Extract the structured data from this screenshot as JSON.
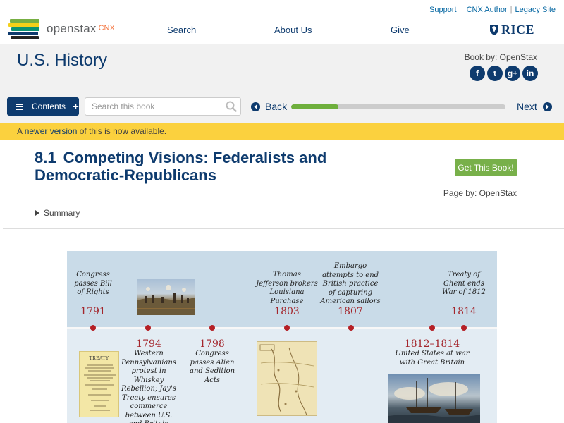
{
  "header": {
    "logo_text": "openstax",
    "logo_suffix": "CNX",
    "util_links": [
      "Support",
      "CNX Author",
      "Legacy Site"
    ],
    "nav": [
      "Search",
      "About Us",
      "Give"
    ],
    "rice": "RICE"
  },
  "book": {
    "title": "U.S. History",
    "book_by": "Book by: OpenStax",
    "social": [
      "f",
      "t",
      "g+",
      "in"
    ]
  },
  "toolbar": {
    "contents_label": "Contents",
    "contents_plus": "+",
    "search_placeholder": "Search this book",
    "back_label": "Back",
    "next_label": "Next",
    "progress_fraction": 0.22
  },
  "notice": {
    "prefix": "A ",
    "link": "newer version",
    "suffix": " of this is now available."
  },
  "module": {
    "number": "8.1",
    "title": "Competing Visions: Federalists and Democratic-Republicans",
    "get_book": "Get This Book!",
    "page_by": "Page by: OpenStax",
    "summary": "Summary"
  },
  "timeline": {
    "colors": {
      "background": "#c9dbe8",
      "accent": "#a4262c",
      "dot": "#b52026"
    },
    "upper_events": [
      {
        "text": "Congress passes Bill of Rights",
        "year": "1791"
      },
      {
        "text": "Thomas Jefferson brokers Louisiana Purchase",
        "year": "1803"
      },
      {
        "text": "Embargo attempts to end British practice of capturing American sailors",
        "year": "1807"
      },
      {
        "text": "Treaty of Ghent ends War of 1812",
        "year": "1814"
      }
    ],
    "lower_events": [
      {
        "year": "1794",
        "text": "Western Pennsylvanians protest in Whiskey Rebellion; Jay's Treaty ensures commerce between U.S. and Britain"
      },
      {
        "year": "1798",
        "text": "Congress passes Alien and Sedition Acts"
      },
      {
        "year": "1812–1814",
        "text": "United States at war with Great Britain"
      }
    ],
    "images": [
      "battle-painting",
      "treaty-document",
      "louisiana-map",
      "naval-battle-painting"
    ],
    "treaty_doc_title": "TREATY"
  }
}
